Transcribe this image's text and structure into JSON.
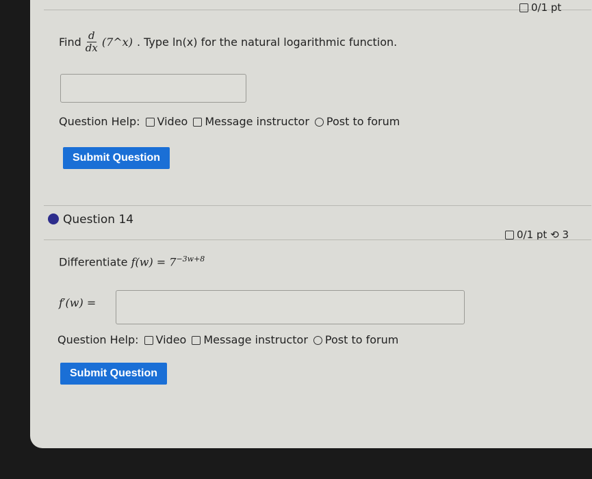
{
  "q13": {
    "score": "0/1 pt",
    "prompt_find": "Find",
    "deriv_num": "d",
    "deriv_den": "dx",
    "expr": "(7^x)",
    "prompt_rest": ". Type ln(x) for the natural logarithmic function.",
    "answer_value": "",
    "help_label": "Question Help:",
    "video": "Video",
    "message": "Message instructor",
    "forum": "Post to forum",
    "submit": "Submit Question"
  },
  "q14": {
    "title": "Question 14",
    "score": "0/1 pt",
    "retries": "3",
    "prompt": "Differentiate",
    "function": "f(w) = 7",
    "exponent": "−3w+8",
    "answer_label": "f′(w) =",
    "answer_value": "",
    "help_label": "Question Help:",
    "video": "Video",
    "message": "Message instructor",
    "forum": "Post to forum",
    "submit": "Submit Question"
  },
  "colors": {
    "accent": "#1a6fd6",
    "dot": "#2d2d8c"
  }
}
